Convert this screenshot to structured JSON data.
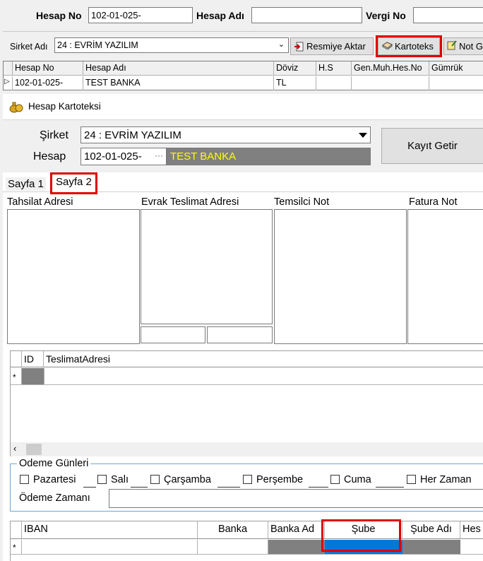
{
  "top": {
    "hesap_no_label": "Hesap No",
    "hesap_no_value": "102-01-025-",
    "hesap_adi_label": "Hesap Adı",
    "hesap_adi_value": "",
    "vergi_no_label": "Vergi No",
    "vergi_no_value": ""
  },
  "toolbar": {
    "sirket_label": "Sirket Adı",
    "sirket_value": "24 : EVRİM YAZILIM",
    "resmiye_button": "Resmiye Aktar",
    "kartoteks_button": "Kartoteks",
    "not_button": "Not G"
  },
  "grid": {
    "columns": [
      "Hesap No",
      "Hesap Adı",
      "Döviz",
      "H.S",
      "Gen.Muh.Hes.No",
      "Gümrük"
    ],
    "rows": [
      [
        "102-01-025-",
        "TEST BANKA",
        "TL",
        "",
        "",
        ""
      ]
    ]
  },
  "kartoteks": {
    "title": "Hesap Kartoteksi",
    "sirket_label": "Şirket",
    "sirket_value": "24 : EVRİM YAZILIM",
    "hesap_label": "Hesap",
    "hesap_code": "102-01-025-",
    "hesap_name": "TEST BANKA",
    "ellipsis": "···",
    "kayit_button": "Kayıt Getir"
  },
  "tabs": [
    "Sayfa 1",
    "Sayfa 2"
  ],
  "sections": {
    "tahsilat": "Tahsilat Adresi",
    "evrak": "Evrak Teslimat Adresi",
    "temsilci": "Temsilci Not",
    "fatura": "Fatura Not"
  },
  "teslimat_grid": {
    "id_col": "ID",
    "adres_col": "TeslimatAdresi",
    "new_row_marker": "*"
  },
  "odeme": {
    "group_title": "Odeme Günleri",
    "days": [
      "Pazartesi",
      "Salı",
      "Çarşamba",
      "Perşembe",
      "Cuma",
      "Her Zaman"
    ],
    "zaman_label": "Ödeme Zamanı",
    "zaman_value": ""
  },
  "iban_grid": {
    "columns": [
      "IBAN",
      "Banka",
      "Banka Ad",
      "Şube",
      "Şube Adı",
      "Hes"
    ],
    "new_row_marker": "*"
  },
  "colors": {
    "highlight_red": "#e00000",
    "hesap_name_bg": "#808080",
    "hesap_name_fg": "#ffff00",
    "selected_cell": "#0078d7"
  }
}
